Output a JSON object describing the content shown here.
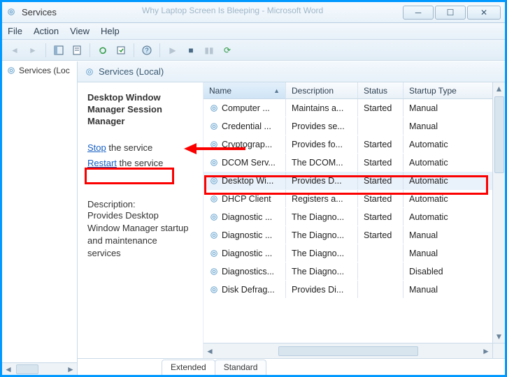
{
  "window": {
    "title": "Services",
    "background_hint": "Why Laptop Screen Is Bleeping - Microsoft Word"
  },
  "menu": {
    "file": "File",
    "action": "Action",
    "view": "View",
    "help": "Help"
  },
  "tree": {
    "root": "Services (Loc"
  },
  "panel": {
    "header": "Services (Local)"
  },
  "details": {
    "service_name": "Desktop Window Manager Session Manager",
    "stop_link": "Stop",
    "stop_suffix": " the service",
    "restart_link": "Restart",
    "restart_suffix": " the service",
    "desc_label": "Description:",
    "desc_text": "Provides Desktop Window Manager startup and maintenance services"
  },
  "columns": {
    "name": "Name",
    "description": "Description",
    "status": "Status",
    "startup": "Startup Type"
  },
  "rows": [
    {
      "name": "Computer ...",
      "desc": "Maintains a...",
      "status": "Started",
      "startup": "Manual"
    },
    {
      "name": "Credential ...",
      "desc": "Provides se...",
      "status": "",
      "startup": "Manual"
    },
    {
      "name": "Cryptograp...",
      "desc": "Provides fo...",
      "status": "Started",
      "startup": "Automatic"
    },
    {
      "name": "DCOM Serv...",
      "desc": "The DCOM...",
      "status": "Started",
      "startup": "Automatic"
    },
    {
      "name": "Desktop Wi...",
      "desc": "Provides D...",
      "status": "Started",
      "startup": "Automatic"
    },
    {
      "name": "DHCP Client",
      "desc": "Registers a...",
      "status": "Started",
      "startup": "Automatic"
    },
    {
      "name": "Diagnostic ...",
      "desc": "The Diagno...",
      "status": "Started",
      "startup": "Automatic"
    },
    {
      "name": "Diagnostic ...",
      "desc": "The Diagno...",
      "status": "Started",
      "startup": "Manual"
    },
    {
      "name": "Diagnostic ...",
      "desc": "The Diagno...",
      "status": "",
      "startup": "Manual"
    },
    {
      "name": "Diagnostics...",
      "desc": "The Diagno...",
      "status": "",
      "startup": "Disabled"
    },
    {
      "name": "Disk Defrag...",
      "desc": "Provides Di...",
      "status": "",
      "startup": "Manual"
    }
  ],
  "selected_row_index": 4,
  "tabs": {
    "extended": "Extended",
    "standard": "Standard"
  },
  "colors": {
    "accent": "#0099ff",
    "highlight": "#fc0000",
    "link": "#1760c4"
  }
}
